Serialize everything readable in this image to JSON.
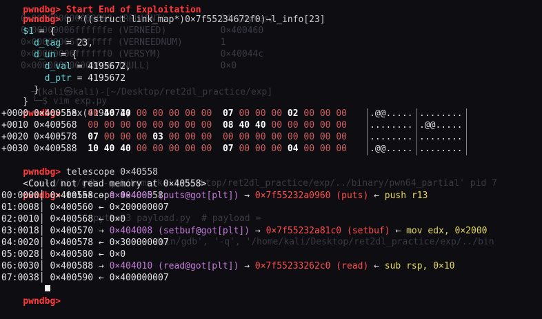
{
  "prompt": "pwndbg>",
  "top_cut": "pwndbg> Start End of Exploitation",
  "cmd1": " p *((struct link_map*)0×7f55234672f0)→l_info[23]",
  "p_result": {
    "var": "$1",
    "open": " = {",
    "d_tag_key": "  d_tag",
    "d_tag_val": " = 23,",
    "d_un_key": "  d_un",
    "d_un_val": " = {",
    "d_val_key": "    d_val",
    "d_val_val": " = 4195672,",
    "d_ptr_key": "    d_ptr",
    "d_ptr_val": " = 4195672",
    "close_inner": "  }",
    "close_outer": "}"
  },
  "cmd2": " hex(4195672)",
  "hex_rows": [
    {
      "off": "+0000",
      "addr": "0×400558",
      "b": [
        "00",
        "40",
        "40",
        "00",
        "00",
        "00",
        "00",
        "00",
        "07",
        "00",
        "00",
        "00",
        "02",
        "00",
        "00",
        "00"
      ],
      "a1": ".@@.....",
      "a2": "........"
    },
    {
      "off": "+0010",
      "addr": "0×400568",
      "b": [
        "00",
        "00",
        "00",
        "00",
        "00",
        "00",
        "00",
        "00",
        "08",
        "40",
        "40",
        "00",
        "00",
        "00",
        "00",
        "00"
      ],
      "a1": "........",
      "a2": ".@@....."
    },
    {
      "off": "+0020",
      "addr": "0×400578",
      "b": [
        "07",
        "00",
        "00",
        "00",
        "03",
        "00",
        "00",
        "00",
        "00",
        "00",
        "00",
        "00",
        "00",
        "00",
        "00",
        "00"
      ],
      "a1": "........",
      "a2": "........"
    },
    {
      "off": "+0030",
      "addr": "0×400588",
      "b": [
        "10",
        "40",
        "40",
        "00",
        "00",
        "00",
        "00",
        "00",
        "07",
        "00",
        "00",
        "00",
        "04",
        "00",
        "00",
        "00"
      ],
      "a1": ".@@.....",
      "a2": "........"
    }
  ],
  "cmd3": " telescope 0×40558",
  "error_line": "<Could not read memory at 0×40558>",
  "cmd4": " telescope 0×400558",
  "tele_rows": [
    {
      "idx": "00:0000",
      "addr": "0×400558",
      "p1": "0×404000",
      "p1s": " (puts@got[plt])",
      "p2": "0×7f55232a0960",
      "p2s": " (puts)",
      "ins": "push r13"
    },
    {
      "idx": "01:0008",
      "addr": "0×400560",
      "v": "0×200000007"
    },
    {
      "idx": "02:0010",
      "addr": "0×400568",
      "v": "0×0"
    },
    {
      "idx": "03:0018",
      "addr": "0×400570",
      "p1": "0×404008",
      "p1s": " (setbuf@got[plt])",
      "p2": "0×7f55232a81c0",
      "p2s": " (setbuf)",
      "ins": "mov edx, 0×2000"
    },
    {
      "idx": "04:0020",
      "addr": "0×400578",
      "v": "0×300000007"
    },
    {
      "idx": "05:0028",
      "addr": "0×400580",
      "v": "0×0"
    },
    {
      "idx": "06:0030",
      "addr": "0×400588",
      "p1": "0×404010",
      "p1s": " (read@got[plt])",
      "p2": "0×7f55233262c0",
      "p2s": " (read)",
      "ins": "sub rsp, 0×10"
    },
    {
      "idx": "07:0038",
      "addr": "0×400590",
      "v": "0×400000007"
    }
  ],
  "arrow": " →",
  "left_arrow": " ←",
  "ghost_lines": [
    "0×000000000000009 (RELAENT)          24 (bytes)",
    "0×00000006ffffffe (VERNEED)          0×400460",
    "0×00000006fffffff (VERNEEDNUM)       1",
    "0×00000006ffffff0 (VERSYM)           0×40044c",
    "0×000000000000000 (NULL)             0×0",
    "  ─(kali㉿kali)-[~/Desktop/ret2dl_practice/exp]",
    "  └─$ vim exp.py",
    "run+ /bin/gdb -q '/home/kali/Desktop/ret2dl_practice/exp/../binary/pwn64_partial' pid 7",
    "  python3 payload.py  # payload = ",
    "  '/bin/gdb', '-q', '/home/kali/Desktop/ret2dl_practice/exp/../bin"
  ]
}
